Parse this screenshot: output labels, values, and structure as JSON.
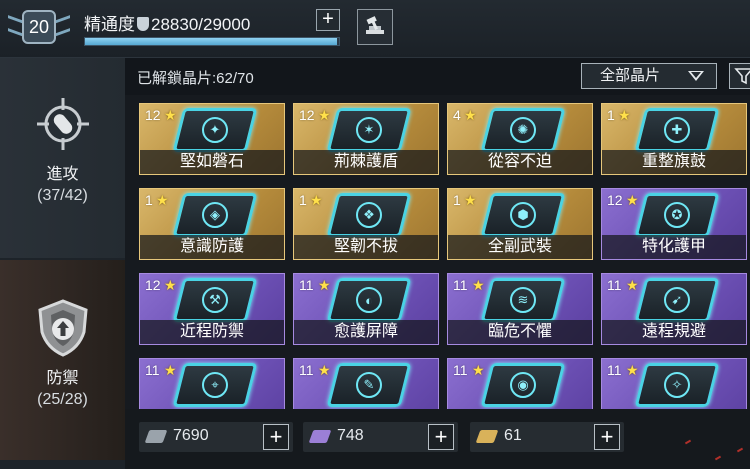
{
  "header": {
    "level": "20",
    "mastery_label": "精通度",
    "mastery_value": "28830/29000",
    "mastery_progress": 0.994,
    "plus_label": "+"
  },
  "sidebar": {
    "tabs": [
      {
        "name": "進攻",
        "count": "(37/42)",
        "icon": "target-bullet-icon",
        "selected": false
      },
      {
        "name": "防禦",
        "count": "(25/28)",
        "icon": "shield-arrow-icon",
        "selected": true
      }
    ]
  },
  "toolbar": {
    "unlocked_text": "已解鎖晶片:62/70",
    "filter_selected": "全部晶片"
  },
  "chips": [
    {
      "level": "12",
      "name": "堅如磐石",
      "rarity": "gold",
      "glyph": "✦"
    },
    {
      "level": "12",
      "name": "荊棘護盾",
      "rarity": "gold",
      "glyph": "✶"
    },
    {
      "level": "4",
      "name": "從容不迫",
      "rarity": "gold",
      "glyph": "✺"
    },
    {
      "level": "1",
      "name": "重整旗鼓",
      "rarity": "gold",
      "glyph": "✚"
    },
    {
      "level": "1",
      "name": "意識防護",
      "rarity": "gold",
      "glyph": "◈"
    },
    {
      "level": "1",
      "name": "堅韌不拔",
      "rarity": "gold",
      "glyph": "❖"
    },
    {
      "level": "1",
      "name": "全副武裝",
      "rarity": "gold",
      "glyph": "⬢"
    },
    {
      "level": "12",
      "name": "特化護甲",
      "rarity": "purple",
      "glyph": "✪"
    },
    {
      "level": "12",
      "name": "近程防禦",
      "rarity": "purple",
      "glyph": "⚒"
    },
    {
      "level": "11",
      "name": "愈護屏障",
      "rarity": "purple",
      "glyph": "◐"
    },
    {
      "level": "11",
      "name": "臨危不懼",
      "rarity": "purple",
      "glyph": "≋"
    },
    {
      "level": "11",
      "name": "遠程規避",
      "rarity": "purple",
      "glyph": "➹"
    },
    {
      "level": "11",
      "name": "",
      "rarity": "purple",
      "glyph": "⌖"
    },
    {
      "level": "11",
      "name": "",
      "rarity": "purple",
      "glyph": "✎"
    },
    {
      "level": "11",
      "name": "",
      "rarity": "purple",
      "glyph": "◉"
    },
    {
      "level": "11",
      "name": "",
      "rarity": "purple",
      "glyph": "✧"
    }
  ],
  "resources": [
    {
      "value": "7690",
      "icon": "gray-crystal-icon",
      "color": "#9aa3ab"
    },
    {
      "value": "748",
      "icon": "purple-crystal-icon",
      "color": "#9b7fd6"
    },
    {
      "value": "61",
      "icon": "gold-crystal-icon",
      "color": "#d9b25a"
    }
  ],
  "colors": {
    "accent": "#56a8d2",
    "gold": "#d9b76a",
    "purple": "#8b6fd0"
  }
}
